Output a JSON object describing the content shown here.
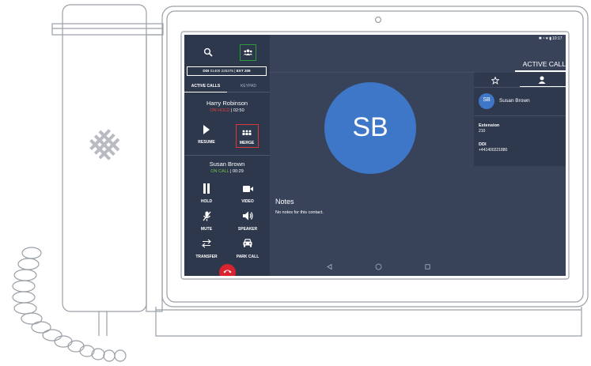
{
  "status_bar": {
    "time": "10:17",
    "icons_right": "✱ ⁴ ♥ ▮"
  },
  "header": {
    "active_call_label": "ACTIVE CALL"
  },
  "sidebar": {
    "ddi_label": "DDI",
    "ddi_number": "01400 225375",
    "ext_label": "EXT",
    "ext_number": "209",
    "tabs": [
      {
        "label": "ACTIVE CALLS"
      },
      {
        "label": "KEYPAD"
      }
    ],
    "call1": {
      "name": "Harry Robinson",
      "status": "ON HOLD",
      "timer": "02:50",
      "actions": [
        {
          "label": "RESUME",
          "icon": "play-icon"
        },
        {
          "label": "MERGE",
          "icon": "merge-icon"
        }
      ]
    },
    "call2": {
      "name": "Susan Brown",
      "status": "ON CALL",
      "timer": "00:29",
      "actions": [
        {
          "label": "HOLD",
          "icon": "pause-icon"
        },
        {
          "label": "VIDEO",
          "icon": "video-icon"
        },
        {
          "label": "MUTE",
          "icon": "mute-icon"
        },
        {
          "label": "SPEAKER",
          "icon": "speaker-icon"
        },
        {
          "label": "TRANSFER",
          "icon": "transfer-icon"
        },
        {
          "label": "PARK CALL",
          "icon": "car-icon"
        }
      ]
    }
  },
  "main": {
    "avatar_initials": "SB",
    "notes_title": "Notes",
    "notes_text": "No notes for this contact."
  },
  "contact_panel": {
    "avatar_initials": "SB",
    "name": "Susan Brown",
    "extension_label": "Extension",
    "extension_value": "210",
    "ddi_label": "DDI",
    "ddi_value": "+441400221880"
  },
  "colors": {
    "screen_bg": "#38435a",
    "sidebar_bg": "#2e384d",
    "avatar_blue": "#3e77c7",
    "on_hold_red": "#e0403a",
    "on_call_green": "#6cc24a",
    "highlight_green": "#2e9a3a",
    "highlight_red": "#d9383a"
  }
}
